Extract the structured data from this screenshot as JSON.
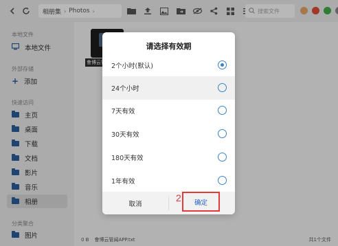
{
  "toolbar": {
    "breadcrumb": [
      "相册集",
      "Photos"
    ],
    "search_placeholder": "搜索文件",
    "window_colors": [
      "#e8a66a",
      "#e04b3a",
      "#3fae49",
      "#8a8a8a"
    ]
  },
  "sidebar": {
    "local_title": "本地文件",
    "local_item": "本地文件",
    "external_title": "外部存储",
    "external_item": "添加",
    "quick_title": "快速访问",
    "quick_items": [
      "主页",
      "桌面",
      "下载",
      "文档",
      "影片",
      "音乐",
      "相册"
    ],
    "category_title": "分类聚合",
    "category_item": "图片"
  },
  "content": {
    "file_label": "會博云管闻APF",
    "status_left": "0 B",
    "status_file": "會博云管闻APP.txt",
    "status_right": "共1个文件"
  },
  "dialog": {
    "title": "请选择有效期",
    "options": [
      {
        "label": "2个小时(默认)",
        "selected": true
      },
      {
        "label": "24个小时",
        "selected": false
      },
      {
        "label": "7天有效",
        "selected": false
      },
      {
        "label": "30天有效",
        "selected": false
      },
      {
        "label": "180天有效",
        "selected": false
      },
      {
        "label": "1年有效",
        "selected": false
      }
    ],
    "cancel_label": "取消",
    "ok_label": "确定",
    "annotation": "2"
  },
  "colors": {
    "accent": "#3b82c4",
    "highlight_border": "#e23a3a",
    "ok_text": "#2563c4"
  }
}
